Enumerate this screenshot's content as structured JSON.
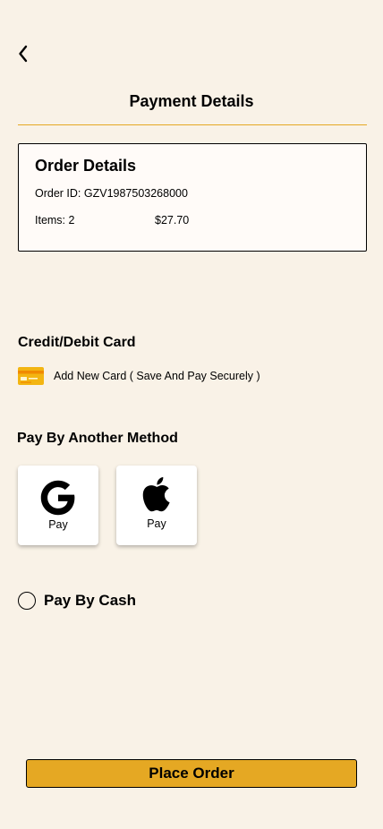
{
  "header": {
    "title": "Payment Details",
    "back_icon": "chevron-left-icon"
  },
  "order_details": {
    "title": "Order Details",
    "order_id": "Order ID: GZV1987503268000",
    "items": "Items: 2",
    "total": "$27.70"
  },
  "card_section": {
    "title": "Credit/Debit Card",
    "add_card_label": "Add New Card ( Save And Pay Securely )",
    "card_icon": "credit-card-icon"
  },
  "other_methods": {
    "title": "Pay By Another Method",
    "options": [
      {
        "label": "Pay",
        "icon": "google-logo-icon"
      },
      {
        "label": "Pay",
        "icon": "apple-logo-icon"
      }
    ]
  },
  "cash": {
    "label": "Pay By Cash",
    "selected": false
  },
  "footer": {
    "place_order_label": "Place Order"
  },
  "colors": {
    "background": "#f9f2e7",
    "accent": "#e5a823",
    "card_background": "#fffbf8"
  }
}
